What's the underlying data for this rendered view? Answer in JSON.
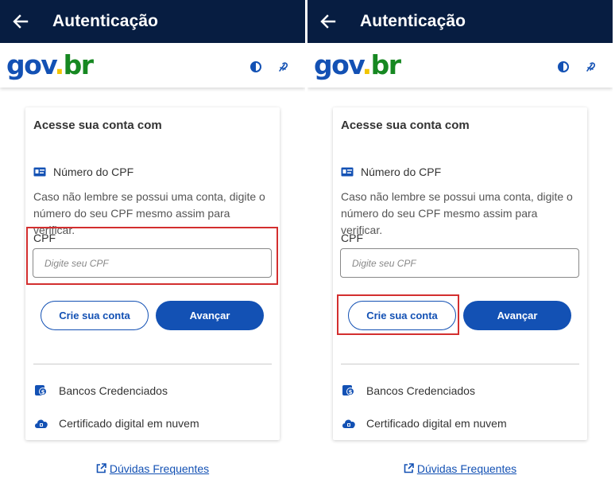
{
  "screens": [
    {
      "topbar": {
        "title": "Autenticação"
      },
      "header": {
        "logo_gov": "gov",
        "logo_dot": ".",
        "logo_br": "br"
      },
      "card": {
        "title": "Acesse sua conta com",
        "cpf_option": "Número do CPF",
        "hint": "Caso não lembre se possui uma conta, digite o número do seu CPF mesmo assim para verificar.",
        "field_label": "CPF",
        "input_placeholder": "Digite seu CPF",
        "input_value": "",
        "create_account": "Crie sua conta",
        "next": "Avançar",
        "alt_banks": "Bancos Credenciados",
        "alt_cloud": "Certificado digital em nuvem"
      },
      "footer": {
        "faq": "Dúvidas Frequentes"
      }
    },
    {
      "topbar": {
        "title": "Autenticação"
      },
      "header": {
        "logo_gov": "gov",
        "logo_dot": ".",
        "logo_br": "br"
      },
      "card": {
        "title": "Acesse sua conta com",
        "cpf_option": "Número do CPF",
        "hint": "Caso não lembre se possui uma conta, digite o número do seu CPF mesmo assim para verificar.",
        "field_label": "CPF",
        "input_placeholder": "Digite seu CPF",
        "input_value": "",
        "create_account": "Crie sua conta",
        "next": "Avançar",
        "alt_banks": "Bancos Credenciados",
        "alt_cloud": "Certificado digital em nuvem"
      },
      "footer": {
        "faq": "Dúvidas Frequentes"
      }
    }
  ],
  "icons": {
    "back": "arrow-left-icon",
    "contrast": "contrast-icon",
    "accessibility": "vlibras-icon",
    "cpf": "id-card-icon",
    "banks": "bank-icon",
    "cloud": "cloud-certificate-icon",
    "external": "external-link-icon"
  },
  "colors": {
    "topbar": "#071d41",
    "primary": "#1351b4",
    "logo_blue": "#1351b4",
    "logo_yellow": "#f2c500",
    "logo_green": "#168821",
    "highlight": "#d32f2f"
  }
}
